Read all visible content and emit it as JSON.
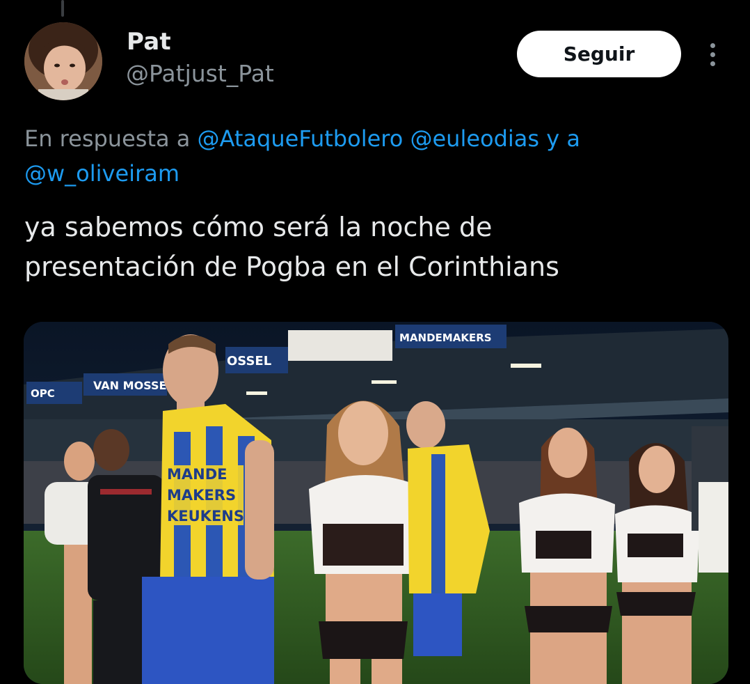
{
  "author": {
    "display_name": "Pat",
    "handle": "@Patjust_Pat"
  },
  "follow_button": {
    "label": "Seguir"
  },
  "more_menu_icon": "more-dots-vertical-icon",
  "reply_context": {
    "prefix": "En respuesta a",
    "mention_1": "@AtaqueFutbolero",
    "mention_2": "@euleodias",
    "connector": "y a",
    "mention_3": "@w_oliveiram"
  },
  "tweet": {
    "line_1": "ya sabemos cómo será la noche de",
    "line_2": "presentación de Pogba en el Corinthians"
  },
  "media": {
    "ad_board_1": "OPC",
    "ad_board_2": "VAN MOSSEL",
    "ad_board_3": "OSSEL",
    "ad_board_4": "MANDEMAKERS",
    "jersey_text_1": "MANDE",
    "jersey_text_2": "MAKERS",
    "jersey_text_3": "KEUKENS"
  },
  "colors": {
    "background": "#000000",
    "text_primary": "#e7e9ea",
    "text_secondary": "#8b949b",
    "link": "#1d9bf0",
    "follow_button_bg": "#ffffff"
  }
}
